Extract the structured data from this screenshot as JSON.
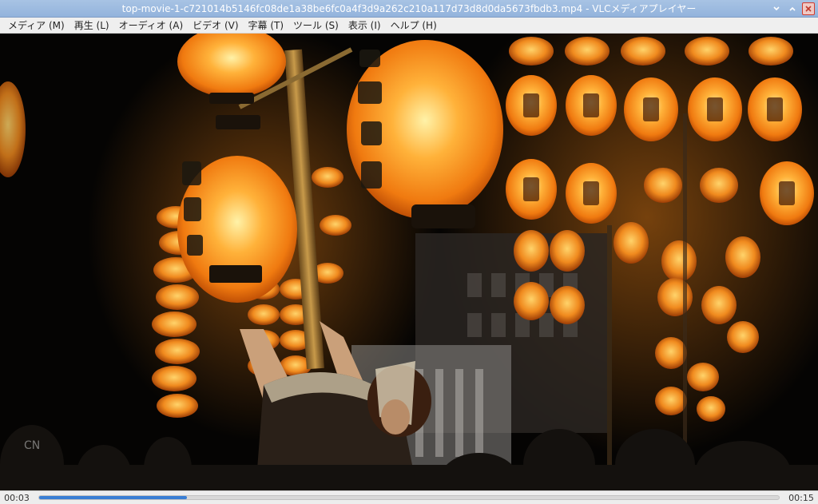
{
  "window": {
    "title": "top-movie-1-c721014b5146fc08de1a38be6fc0a4f3d9a262c210a117d73d8d0da5673fbdb3.mp4 - VLCメディアプレイヤー",
    "controls": [
      "minimize-icon",
      "maximize-icon",
      "close-icon"
    ]
  },
  "menu": {
    "items": [
      {
        "label": "メディア (M)"
      },
      {
        "label": "再生 (L)"
      },
      {
        "label": "オーディオ (A)"
      },
      {
        "label": "ビデオ (V)"
      },
      {
        "label": "字幕 (T)"
      },
      {
        "label": "ツール (S)"
      },
      {
        "label": "表示 (I)"
      },
      {
        "label": "ヘルプ (H)"
      }
    ]
  },
  "video": {
    "content": "festival-lanterns-frame"
  },
  "playback": {
    "elapsed": "00:03",
    "total": "00:15",
    "progress": 0.2
  },
  "colors": {
    "titlebar": "#a8c3e4",
    "accent": "#3a7fd5",
    "close_border": "#d23b2e"
  }
}
